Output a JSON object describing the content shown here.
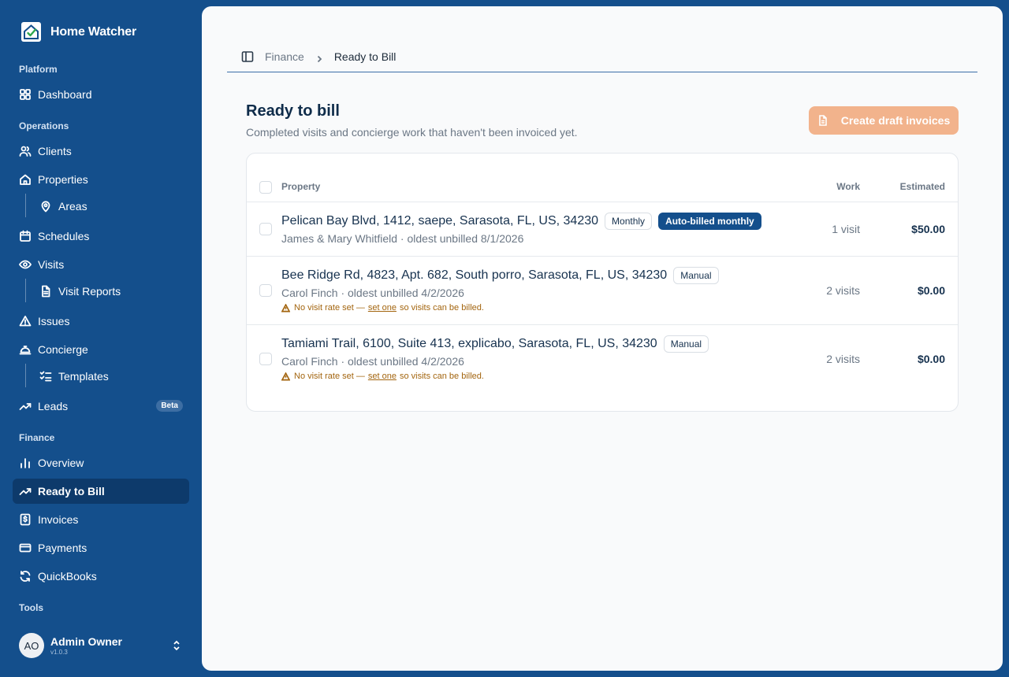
{
  "brand": {
    "name": "Home Watcher"
  },
  "sidebar": {
    "sections": {
      "platform": "Platform",
      "operations": "Operations",
      "finance": "Finance",
      "tools": "Tools"
    },
    "items": {
      "dashboard": "Dashboard",
      "clients": "Clients",
      "properties": "Properties",
      "areas": "Areas",
      "schedules": "Schedules",
      "visits": "Visits",
      "visit_reports": "Visit Reports",
      "issues": "Issues",
      "concierge": "Concierge",
      "templates": "Templates",
      "leads": "Leads",
      "leads_badge": "Beta",
      "overview": "Overview",
      "ready_to_bill": "Ready to Bill",
      "invoices": "Invoices",
      "payments": "Payments",
      "quickbooks": "QuickBooks"
    },
    "active_item": "ready_to_bill"
  },
  "user": {
    "initials": "AO",
    "name": "Admin Owner",
    "version": "v1.0.3"
  },
  "breadcrumb": {
    "parent": "Finance",
    "current": "Ready to Bill"
  },
  "page": {
    "title": "Ready to bill",
    "subtitle": "Completed visits and concierge work that haven't been invoiced yet.",
    "create_button": "Create draft invoices"
  },
  "table": {
    "columns": {
      "property": "Property",
      "work": "Work",
      "estimated": "Estimated"
    },
    "rows": [
      {
        "address": "Pelican Bay Blvd, 1412, saepe, Sarasota, FL, US, 34230",
        "badges": [
          "Monthly",
          "Auto-billed monthly"
        ],
        "subtitle": "James & Mary Whitfield · oldest unbilled 8/1/2026",
        "work": "1 visit",
        "estimated": "$50.00"
      },
      {
        "address": "Bee Ridge Rd, 4823, Apt. 682, South porro, Sarasota, FL, US, 34230",
        "badges": [
          "Manual"
        ],
        "subtitle": "Carol Finch · oldest unbilled 4/2/2026",
        "warning_prefix": "No visit rate set —",
        "warning_link": "set one",
        "warning_suffix": "so visits can be billed.",
        "work": "2 visits",
        "estimated": "$0.00"
      },
      {
        "address": "Tamiami Trail, 6100, Suite 413, explicabo, Sarasota, FL, US, 34230",
        "badges": [
          "Manual"
        ],
        "subtitle": "Carol Finch · oldest unbilled 4/2/2026",
        "warning_prefix": "No visit rate set —",
        "warning_link": "set one",
        "warning_suffix": "so visits can be billed.",
        "work": "2 visits",
        "estimated": "$0.00"
      }
    ]
  },
  "colors": {
    "sidebar_bg": "#144f8c",
    "active_item_bg": "#0d3a6b",
    "primary_button": "#f2b38c",
    "badge_solid": "#144f8c",
    "warning": "#a3650f"
  }
}
